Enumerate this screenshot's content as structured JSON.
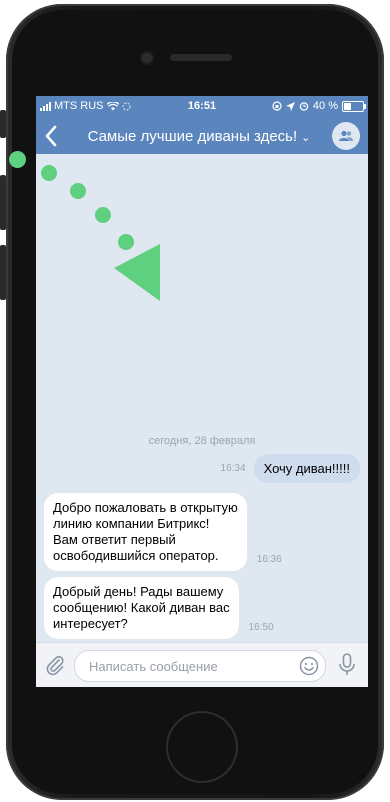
{
  "status_bar": {
    "carrier": "MTS RUS",
    "time": "16:51",
    "battery": "40 %",
    "battery_level_percent": 40
  },
  "navbar": {
    "back_icon": "chevron-left-icon",
    "title": "Самые лучшие диваны здесь!",
    "title_chevron_icon": "chevron-down-icon",
    "avatar_icon": "group-icon"
  },
  "chat": {
    "date_separator": "сегодня, 28 февраля",
    "messages": [
      {
        "direction": "out",
        "text": "Хочу диван!!!!!",
        "time": "16:34"
      },
      {
        "direction": "in",
        "lines": [
          "Добро пожаловать в открытую",
          "линию компании Битрикс!",
          "Вам ответит первый",
          "освободившийся оператор."
        ],
        "time": "16:36"
      },
      {
        "direction": "in",
        "lines": [
          "Добрый день! Рады вашему",
          "сообщению! Какой диван вас",
          "интересует?"
        ],
        "time": "16:50"
      }
    ]
  },
  "input_bar": {
    "placeholder": "Написать сообщение",
    "attach_icon": "paperclip-icon",
    "emoji_icon": "smile-icon",
    "mic_icon": "microphone-icon"
  },
  "colors": {
    "header": "#5b86bd",
    "chat_background": "#dfe7f1",
    "outgoing_bubble": "#cfdcee",
    "hint_arrow": "#5fcf80"
  }
}
